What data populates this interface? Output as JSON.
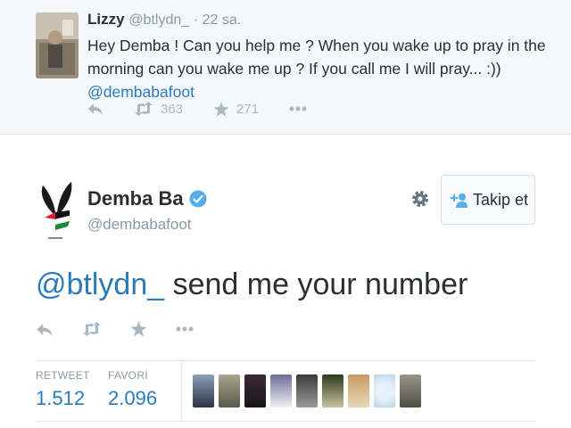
{
  "reply_tweet": {
    "name": "Lizzy",
    "handle": "@btlydn_",
    "time": "· 22 sa.",
    "text": "Hey Demba ! Can you help me ? When you wake up to pray in the morning can you wake me up ? If you call me I will pray...  :)) ",
    "mention": "@dembabafoot",
    "retweet_count": "363",
    "favorite_count": "271"
  },
  "main_tweet": {
    "name": "Demba Ba",
    "handle": "@dembabafoot",
    "follow_label": "Takip et",
    "mention": "@btlydn_",
    "text": " send me your number",
    "retweet_label": "RETWEET",
    "retweet_value": "1.512",
    "favorite_label": "FAVORİ",
    "favorite_value": "2.096"
  },
  "favoriter_avatars": [
    "avatar-1",
    "avatar-2",
    "avatar-3",
    "avatar-4",
    "avatar-5",
    "avatar-6",
    "avatar-7",
    "avatar-8",
    "avatar-9"
  ],
  "colors": {
    "link": "#2b7bb9",
    "verified": "#55acee",
    "muted": "#8899a6",
    "icon": "#aab8c2"
  }
}
